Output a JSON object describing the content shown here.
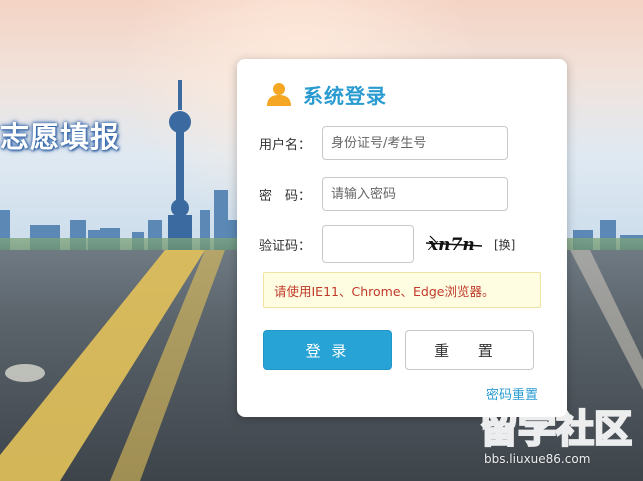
{
  "page": {
    "heading": "志愿填报"
  },
  "login": {
    "title": "系统登录",
    "username_label": "用户名：",
    "username_placeholder": "身份证号/考生号",
    "password_label": "密　码：",
    "password_placeholder": "请输入密码",
    "captcha_label": "验证码：",
    "captcha_value": "",
    "captcha_image_text": "xn7n",
    "captcha_refresh_label": "[换]",
    "notice_text": "请使用IE11、Chrome、Edge浏览器。",
    "login_button": "登 录",
    "reset_button": "重 置",
    "reset_password_link": "密码重置"
  },
  "watermark": {
    "logo_text": "留学社区",
    "url": "bbs.liuxue86.com"
  },
  "colors": {
    "accent": "#27a3d6",
    "title": "#2a9bd1",
    "notice_text": "#c0392b",
    "notice_bg": "#fffde1",
    "user_icon": "#f5a623"
  },
  "icons": {
    "title_icon": "user-icon"
  }
}
